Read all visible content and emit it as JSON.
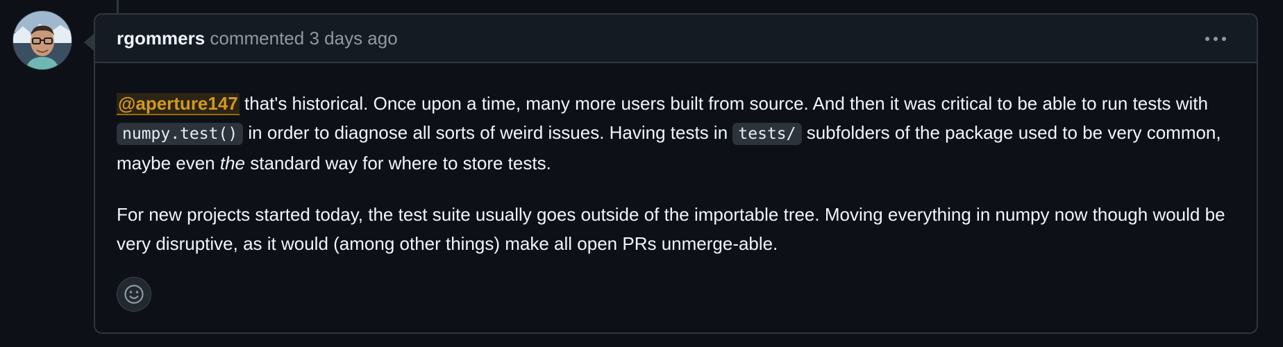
{
  "comment": {
    "author": "rgommers",
    "action": "commented",
    "timestamp": "3 days ago",
    "menu_icon": "kebab-horizontal-icon",
    "paragraph1": {
      "mention": "@aperture147",
      "text1": " that's historical. Once upon a time, many more users built from source. And then it was critical to be able to run tests with ",
      "code1": "numpy.test()",
      "text2": " in order to diagnose all sorts of weird issues. Having tests in ",
      "code2": "tests/",
      "text3": " subfolders of the package used to be very common, maybe even ",
      "emphasis": "the",
      "text4": " standard way for where to store tests."
    },
    "paragraph2": "For new projects started today, the test suite usually goes outside of the importable tree. Moving everything in numpy now though would be very disruptive, as it would (among other things) make all open PRs unmerge-able.",
    "reaction_icon": "smiley-icon"
  },
  "colors": {
    "background": "#0d1117",
    "header_bg": "#151b23",
    "border": "#30363d",
    "mention": "#d29922",
    "muted": "#9198a1"
  }
}
